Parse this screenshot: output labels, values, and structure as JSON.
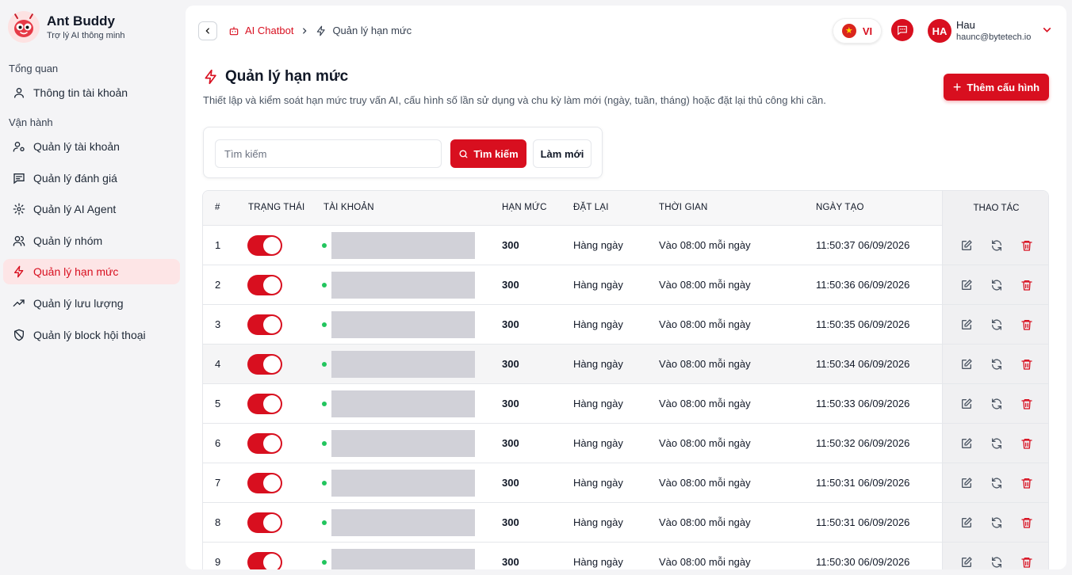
{
  "brand": {
    "title": "Ant Buddy",
    "subtitle": "Trợ lý AI thông minh"
  },
  "sidebar": {
    "section_overview": "Tổng quan",
    "section_operations": "Vận hành",
    "items": [
      {
        "label": "Thông tin tài khoản",
        "icon": "user-icon"
      },
      {
        "label": "Quản lý tài khoản",
        "icon": "user-gear-icon"
      },
      {
        "label": "Quản lý đánh giá",
        "icon": "message-square-icon"
      },
      {
        "label": "Quản lý AI Agent",
        "icon": "gear-icon"
      },
      {
        "label": "Quản lý nhóm",
        "icon": "users-icon"
      },
      {
        "label": "Quản lý hạn mức",
        "icon": "zap-icon",
        "active": true
      },
      {
        "label": "Quản lý lưu lượng",
        "icon": "trending-up-icon"
      },
      {
        "label": "Quản lý block hội thoại",
        "icon": "shield-off-icon"
      }
    ]
  },
  "header": {
    "breadcrumb_parent": "AI Chatbot",
    "breadcrumb_current": "Quản lý hạn mức",
    "language": "VI",
    "user_initials": "HA",
    "user_name": "Hau",
    "user_email": "haunc@bytetech.io"
  },
  "page": {
    "title": "Quản lý hạn mức",
    "description": "Thiết lập và kiểm soát hạn mức truy vấn AI, cấu hình số lần sử dụng và chu kỳ làm mới (ngày, tuần, tháng) hoặc đặt lại thủ công khi cần.",
    "add_button": "Thêm cấu hình"
  },
  "search": {
    "placeholder": "Tìm kiếm",
    "value": "",
    "search_button": "Tìm kiếm",
    "refresh_button": "Làm mới"
  },
  "table": {
    "columns": [
      "#",
      "TRẠNG THÁI",
      "TÀI KHOẢN",
      "HẠN MỨC",
      "ĐẶT LẠI",
      "THỜI GIAN",
      "NGÀY TẠO",
      "THAO TÁC"
    ],
    "rows": [
      {
        "index": "1",
        "enabled": true,
        "limit": "300",
        "reset": "Hàng ngày",
        "time": "Vào 08:00 mỗi ngày",
        "created": "11:50:37 06/09/2026"
      },
      {
        "index": "2",
        "enabled": true,
        "limit": "300",
        "reset": "Hàng ngày",
        "time": "Vào 08:00 mỗi ngày",
        "created": "11:50:36 06/09/2026"
      },
      {
        "index": "3",
        "enabled": true,
        "limit": "300",
        "reset": "Hàng ngày",
        "time": "Vào 08:00 mỗi ngày",
        "created": "11:50:35 06/09/2026"
      },
      {
        "index": "4",
        "enabled": true,
        "limit": "300",
        "reset": "Hàng ngày",
        "time": "Vào 08:00 mỗi ngày",
        "created": "11:50:34 06/09/2026"
      },
      {
        "index": "5",
        "enabled": true,
        "limit": "300",
        "reset": "Hàng ngày",
        "time": "Vào 08:00 mỗi ngày",
        "created": "11:50:33 06/09/2026"
      },
      {
        "index": "6",
        "enabled": true,
        "limit": "300",
        "reset": "Hàng ngày",
        "time": "Vào 08:00 mỗi ngày",
        "created": "11:50:32 06/09/2026"
      },
      {
        "index": "7",
        "enabled": true,
        "limit": "300",
        "reset": "Hàng ngày",
        "time": "Vào 08:00 mỗi ngày",
        "created": "11:50:31 06/09/2026"
      },
      {
        "index": "8",
        "enabled": true,
        "limit": "300",
        "reset": "Hàng ngày",
        "time": "Vào 08:00 mỗi ngày",
        "created": "11:50:31 06/09/2026"
      },
      {
        "index": "9",
        "enabled": true,
        "limit": "300",
        "reset": "Hàng ngày",
        "time": "Vào 08:00 mỗi ngày",
        "created": "11:50:30 06/09/2026"
      }
    ]
  },
  "colors": {
    "accent": "#d80f1f",
    "active_bg": "#fde5e6",
    "status_online": "#22c55e"
  }
}
